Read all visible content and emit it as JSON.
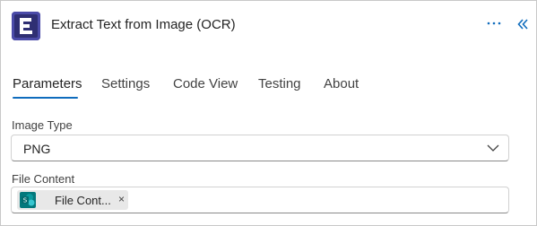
{
  "header": {
    "title": "Extract Text from Image (OCR)",
    "app_icon": "document-e-icon",
    "more_icon": "ellipsis-icon",
    "collapse_icon": "double-chevron-left-icon",
    "accent_color": "#0f6cbd"
  },
  "tabs": [
    {
      "label": "Parameters",
      "active": true
    },
    {
      "label": "Settings",
      "active": false
    },
    {
      "label": "Code View",
      "active": false
    },
    {
      "label": "Testing",
      "active": false
    },
    {
      "label": "About",
      "active": false
    }
  ],
  "parameters": {
    "image_type": {
      "label": "Image Type",
      "value": "PNG",
      "icon": "chevron-down-icon"
    },
    "file_content": {
      "label": "File Content",
      "token_label": "File Cont...",
      "token_icon": "sharepoint-icon",
      "remove_glyph": "×"
    }
  }
}
